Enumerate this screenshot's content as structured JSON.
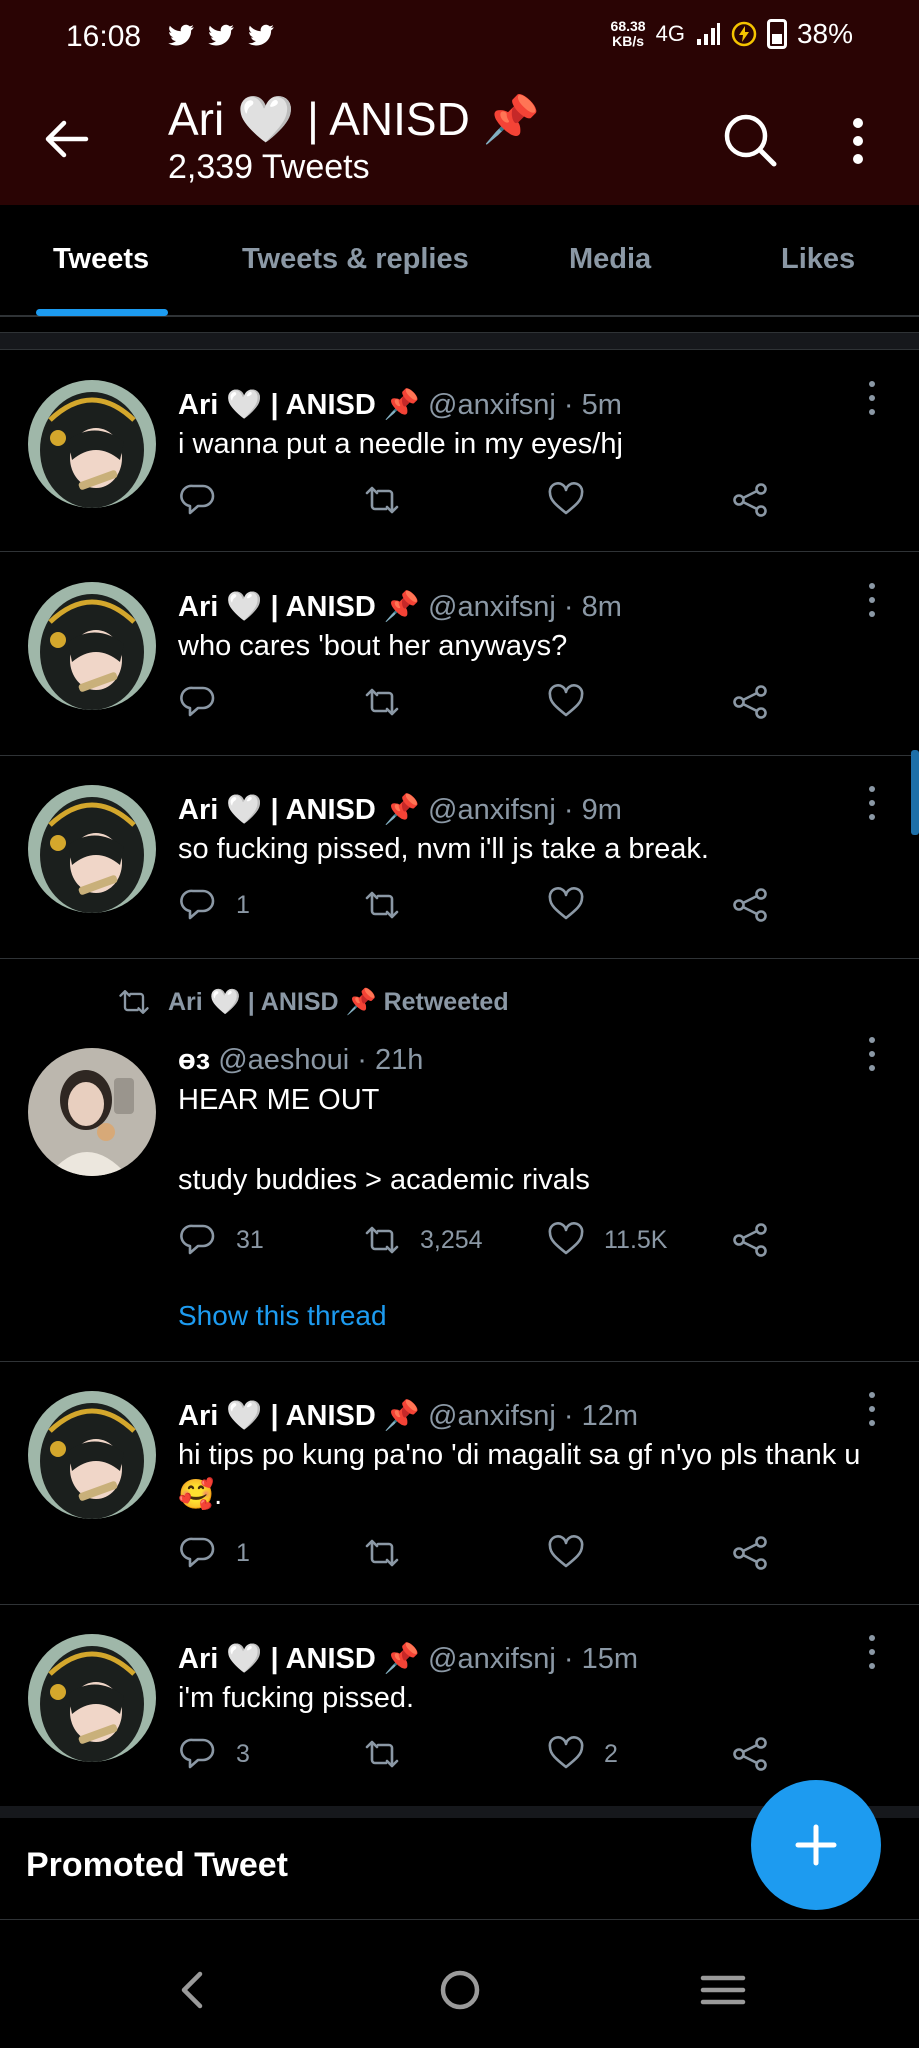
{
  "status_bar": {
    "time": "16:08",
    "speed": "68.38",
    "speed_unit": "KB/s",
    "network": "4G",
    "battery": "38%"
  },
  "header": {
    "title": "Ari 🤍 | ANISD 📌",
    "tweet_count": "2,339 Tweets"
  },
  "tabs": [
    {
      "label": "Tweets"
    },
    {
      "label": "Tweets & replies"
    },
    {
      "label": "Media"
    },
    {
      "label": "Likes"
    }
  ],
  "tweets": [
    {
      "name": "Ari 🤍 | ANISD 📌",
      "meta": " @anxifsnj · 5m",
      "text": "i wanna put a needle in my eyes/hj",
      "replies": "",
      "retweets": "",
      "likes": ""
    },
    {
      "name": "Ari 🤍 | ANISD 📌",
      "meta": " @anxifsnj · 8m",
      "text": "who cares 'bout her anyways?",
      "replies": "",
      "retweets": "",
      "likes": ""
    },
    {
      "name": "Ari 🤍 | ANISD 📌",
      "meta": " @anxifsnj · 9m",
      "text": "so fucking pissed, nvm i'll js take a break.",
      "replies": "1",
      "retweets": "",
      "likes": ""
    },
    {
      "retweet_label": "Ari 🤍 | ANISD 📌 Retweeted",
      "name": "ɵɜ",
      "meta": " @aeshoui · 21h",
      "text": "HEAR ME OUT\n\nstudy buddies > academic rivals",
      "replies": "31",
      "retweets": "3,254",
      "likes": "11.5K",
      "show_thread": "Show this thread"
    },
    {
      "name": "Ari 🤍 | ANISD 📌",
      "meta": " @anxifsnj · 12m",
      "text": "hi tips po kung pa'no 'di magalit sa gf n'yo pls thank u 🥰.",
      "replies": "1",
      "retweets": "",
      "likes": ""
    },
    {
      "name": "Ari 🤍 | ANISD 📌",
      "meta": " @anxifsnj · 15m",
      "text": "i'm fucking pissed.",
      "replies": "3",
      "retweets": "",
      "likes": "2"
    }
  ],
  "promoted": {
    "label": "Promoted Tweet"
  },
  "colors": {
    "header_bg": "#2a0404",
    "accent": "#1d9bf0",
    "muted": "#8b98a5"
  }
}
